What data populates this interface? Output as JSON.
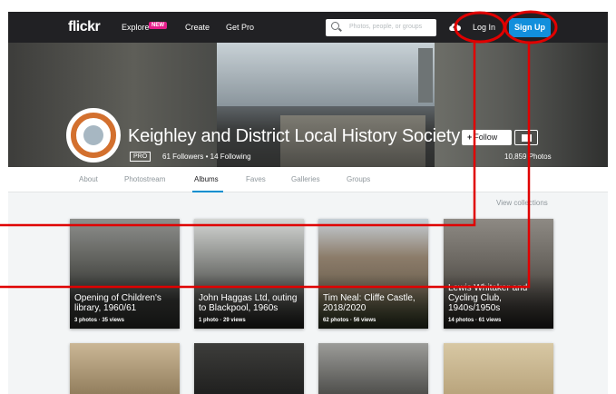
{
  "nav": {
    "logo": "flickr",
    "explore": "Explore",
    "explore_badge": "NEW",
    "create": "Create",
    "get_pro": "Get Pro",
    "search_placeholder": "Photos, people, or groups",
    "log_in": "Log In",
    "sign_up": "Sign Up"
  },
  "profile": {
    "name": "Keighley and District Local History Society",
    "pro_badge": "PRO",
    "followers": "61 Followers",
    "separator": "•",
    "following": "14 Following",
    "follow_label": "Follow",
    "photo_count": "10,859 Photos"
  },
  "tabs": [
    "About",
    "Photostream",
    "Albums",
    "Faves",
    "Galleries",
    "Groups"
  ],
  "active_tab": "Albums",
  "view_collections": "View collections",
  "albums": [
    {
      "title": "Opening of Children's library, 1960/61",
      "meta": "3 photos  ·  35 views"
    },
    {
      "title": "John Haggas Ltd, outing to Blackpool, 1960s",
      "meta": "1 photo  ·  29 views"
    },
    {
      "title": "Tim Neal: Cliffe Castle, 2018/2020",
      "meta": "62 photos  ·  56 views"
    },
    {
      "title": "Lewis Whitaker and Cycling Club, 1940s/1950s",
      "meta": "14 photos  ·  61 views"
    }
  ],
  "colors": {
    "nav_bg": "#212124",
    "signup_blue": "#128fdc",
    "tab_underline": "#008ecf",
    "annotation_red": "#e00000",
    "explore_badge": "#e61e8c"
  },
  "icons": {
    "search": "search-icon",
    "upload": "cloud-upload-icon",
    "mail": "mail-icon"
  }
}
